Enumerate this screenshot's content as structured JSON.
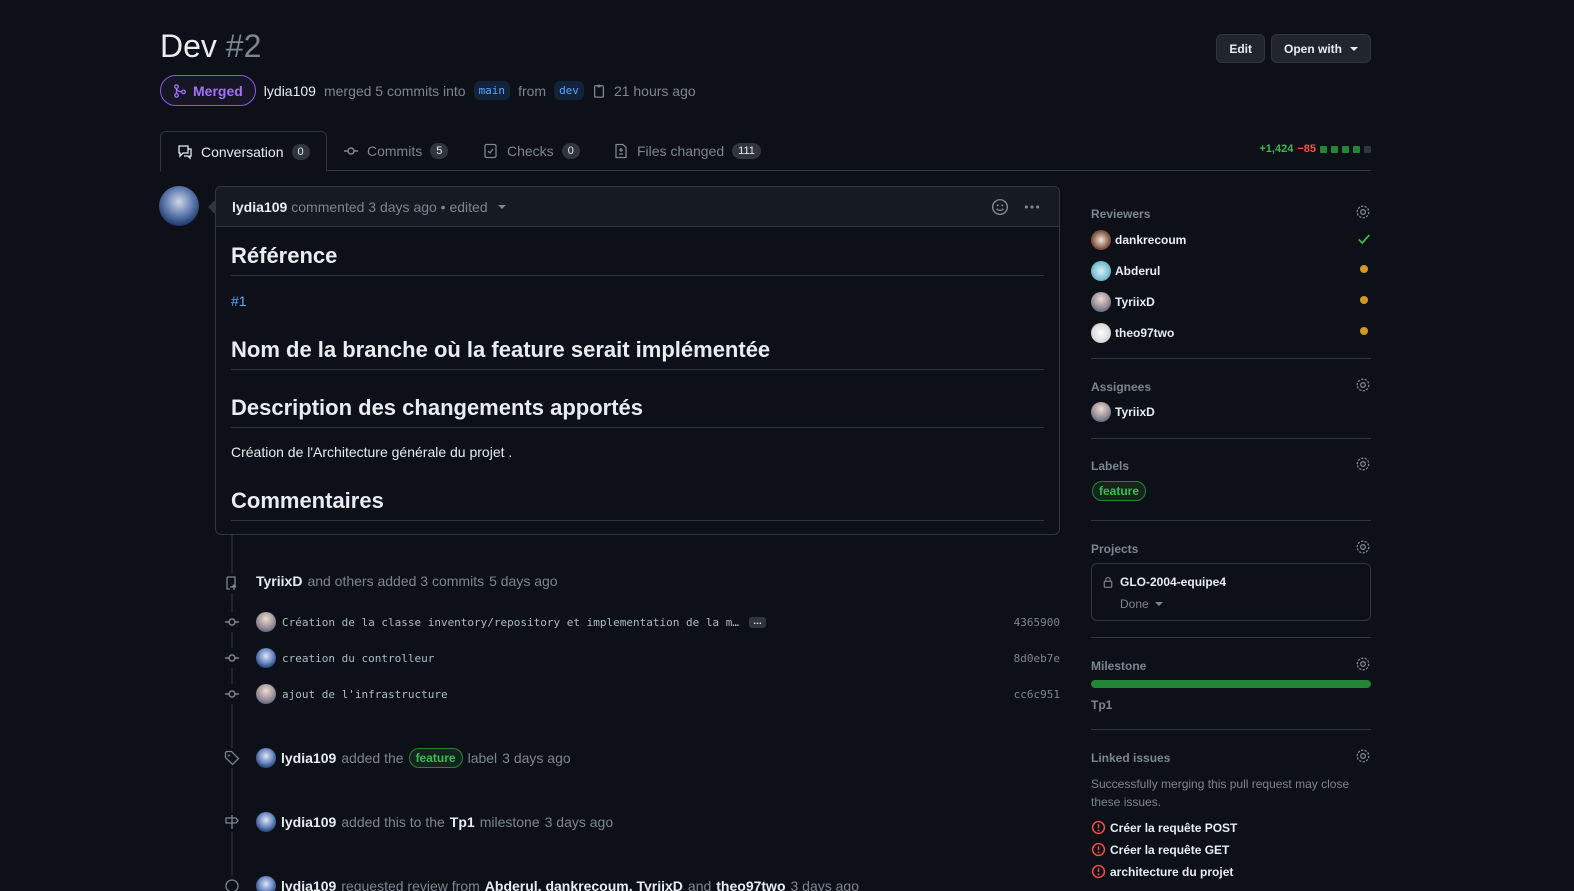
{
  "pr": {
    "title": "Dev",
    "number": "#2",
    "state": "Merged",
    "author": "lydia109",
    "merge_text": "merged 5 commits into",
    "base_branch": "main",
    "from_text": "from",
    "head_branch": "dev",
    "time": "21 hours ago"
  },
  "header_buttons": {
    "edit": "Edit",
    "open_with": "Open with"
  },
  "tabs": [
    {
      "label": "Conversation",
      "count": "0"
    },
    {
      "label": "Commits",
      "count": "5"
    },
    {
      "label": "Checks",
      "count": "0"
    },
    {
      "label": "Files changed",
      "count": "111"
    }
  ],
  "diffstat": {
    "additions": "+1,424",
    "deletions": "−85"
  },
  "comment": {
    "author": "lydia109",
    "meta": "commented 3 days ago • edited",
    "h_reference": "Référence",
    "issue_link": "#1",
    "h_branch": "Nom de la branche où la feature serait implémentée",
    "h_description": "Description des changements apportés",
    "description": "Création de l'Architecture générale du projet .",
    "h_comments": "Commentaires"
  },
  "timeline": {
    "commits_event": {
      "actor": "TyriixD",
      "text": "and others added 3 commits",
      "time": "5 days ago"
    },
    "commits": [
      {
        "message": "Création de la classe inventory/repository et implementation de la m…",
        "more": "…",
        "sha": "4365900"
      },
      {
        "message": "creation du controlleur",
        "sha": "8d0eb7e"
      },
      {
        "message": "ajout de l'infrastructure",
        "sha": "cc6c951"
      }
    ],
    "label_event": {
      "actor": "lydia109",
      "text1": "added the",
      "label": "feature",
      "text2": "label",
      "time": "3 days ago"
    },
    "milestone_event": {
      "actor": "lydia109",
      "text1": "added this to the",
      "milestone": "Tp1",
      "text2": "milestone",
      "time": "3 days ago"
    },
    "review_event": {
      "actor": "lydia109",
      "text1": "requested review from",
      "reviewers": "Abderul, dankrecoum, TyriixD",
      "text2": "and",
      "last": "theo97two",
      "time": "3 days ago"
    }
  },
  "sidebar": {
    "reviewers_title": "Reviewers",
    "reviewers": [
      {
        "name": "dankrecoum",
        "status": "approved"
      },
      {
        "name": "Abderul",
        "status": "pending"
      },
      {
        "name": "TyriixD",
        "status": "pending"
      },
      {
        "name": "theo97two",
        "status": "pending"
      }
    ],
    "assignees_title": "Assignees",
    "assignee": "TyriixD",
    "labels_title": "Labels",
    "label": "feature",
    "projects_title": "Projects",
    "project_name": "GLO-2004-equipe4",
    "project_status": "Done",
    "milestone_title": "Milestone",
    "milestone_progress": 1.0,
    "milestone_name": "Tp1",
    "linked_title": "Linked issues",
    "linked_desc": "Successfully merging this pull request may close these issues.",
    "linked_issues": [
      "Créer la requête POST",
      "Créer la requête GET",
      "architecture du projet"
    ]
  },
  "colors": {
    "merged": "#a371f7",
    "accent": "#58a6ff",
    "green": "#3fb950",
    "red": "#f85149",
    "pending": "#d29922"
  }
}
